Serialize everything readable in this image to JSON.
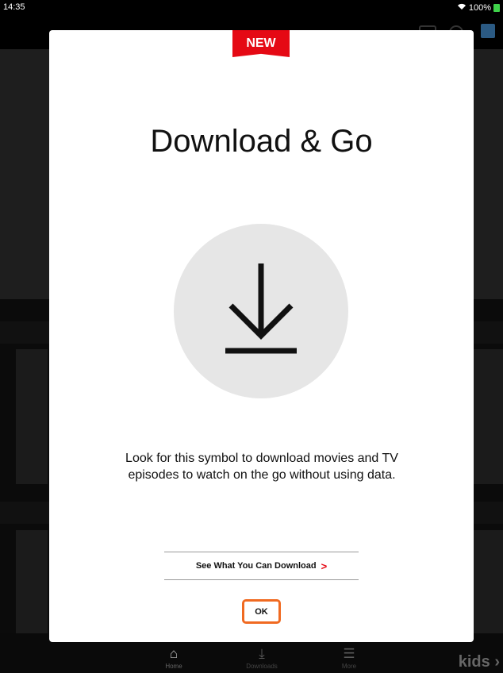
{
  "status_bar": {
    "time": "14:35",
    "battery": "100%",
    "wifi_icon": "wifi-icon",
    "battery_color": "#3fd24a"
  },
  "background_app": {
    "tabs": [
      {
        "label": "Home",
        "icon": "home-icon"
      },
      {
        "label": "Downloads",
        "icon": "download-icon"
      },
      {
        "label": "More",
        "icon": "menu-icon"
      }
    ],
    "kids_label": "kids"
  },
  "modal": {
    "badge": "NEW",
    "badge_color": "#e50914",
    "title": "Download & Go",
    "hero_icon": "download-icon",
    "description": "Look for this symbol to download movies and TV episodes to watch on the go without using data.",
    "link_label": "See What You Can Download",
    "link_chevron": ">",
    "ok_label": "OK",
    "ok_highlight_color": "#f06a21"
  }
}
